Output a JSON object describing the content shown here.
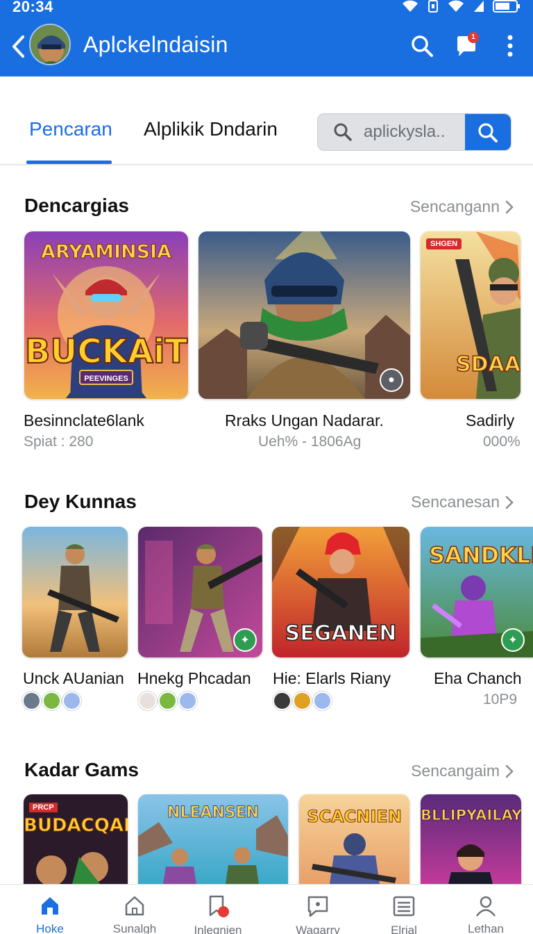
{
  "status": {
    "time": "20:34"
  },
  "header": {
    "title": "Aplckelndaisin"
  },
  "tabs": [
    {
      "label": "Pencaran"
    },
    {
      "label": "Alplikik Dndarin"
    }
  ],
  "search": {
    "placeholder": "aplickysla.."
  },
  "notifications": {
    "count": "1"
  },
  "sections": [
    {
      "title": "Dencargias",
      "more": "Sencangann",
      "items": [
        {
          "name": "Besinnclate6lank",
          "sub": "Spiat : 280",
          "art_title": "ARYAMINSIA",
          "art_logo": "BUCKAiT",
          "art_tag": "PEEVINGES"
        },
        {
          "name": "Rraks Ungan Nadarar.",
          "sub": "Ueh% - 1806Ag"
        },
        {
          "name": "Sadirly",
          "sub": "000%",
          "art_tag": "SHGEN",
          "art_logo": "SDAA"
        }
      ]
    },
    {
      "title": "Dey Kunnas",
      "more": "Sencanesan",
      "items": [
        {
          "name": "Unck AUanian"
        },
        {
          "name": "Hnekg Phcadan"
        },
        {
          "name": "Hie: Elarls Riany",
          "art_logo": "SEGANEN"
        },
        {
          "name": "Eha Chanch",
          "sub": "10P9",
          "art_logo": "SANDKLIELL"
        }
      ]
    },
    {
      "title": "Kadar Gams",
      "more": "Sencangaim",
      "items": [
        {
          "art_logo": "BUDACQAE",
          "art_tag": "PRCP"
        },
        {
          "art_logo": "NLEANSEN"
        },
        {
          "art_logo": "SCACNIEN"
        },
        {
          "art_logo": "BLLIPYAILAY"
        }
      ]
    }
  ],
  "bottom_nav": [
    {
      "label": "Hoke"
    },
    {
      "label": "Sunalgh"
    },
    {
      "label": "Inlegnien"
    },
    {
      "label": "Wagarry"
    },
    {
      "label": "Elrial"
    },
    {
      "label": "Lethan"
    }
  ],
  "colors": {
    "primary": "#1a6fe0",
    "muted": "#8a8d92",
    "badge_green": "#2e9d52",
    "alert_red": "#e53935"
  }
}
